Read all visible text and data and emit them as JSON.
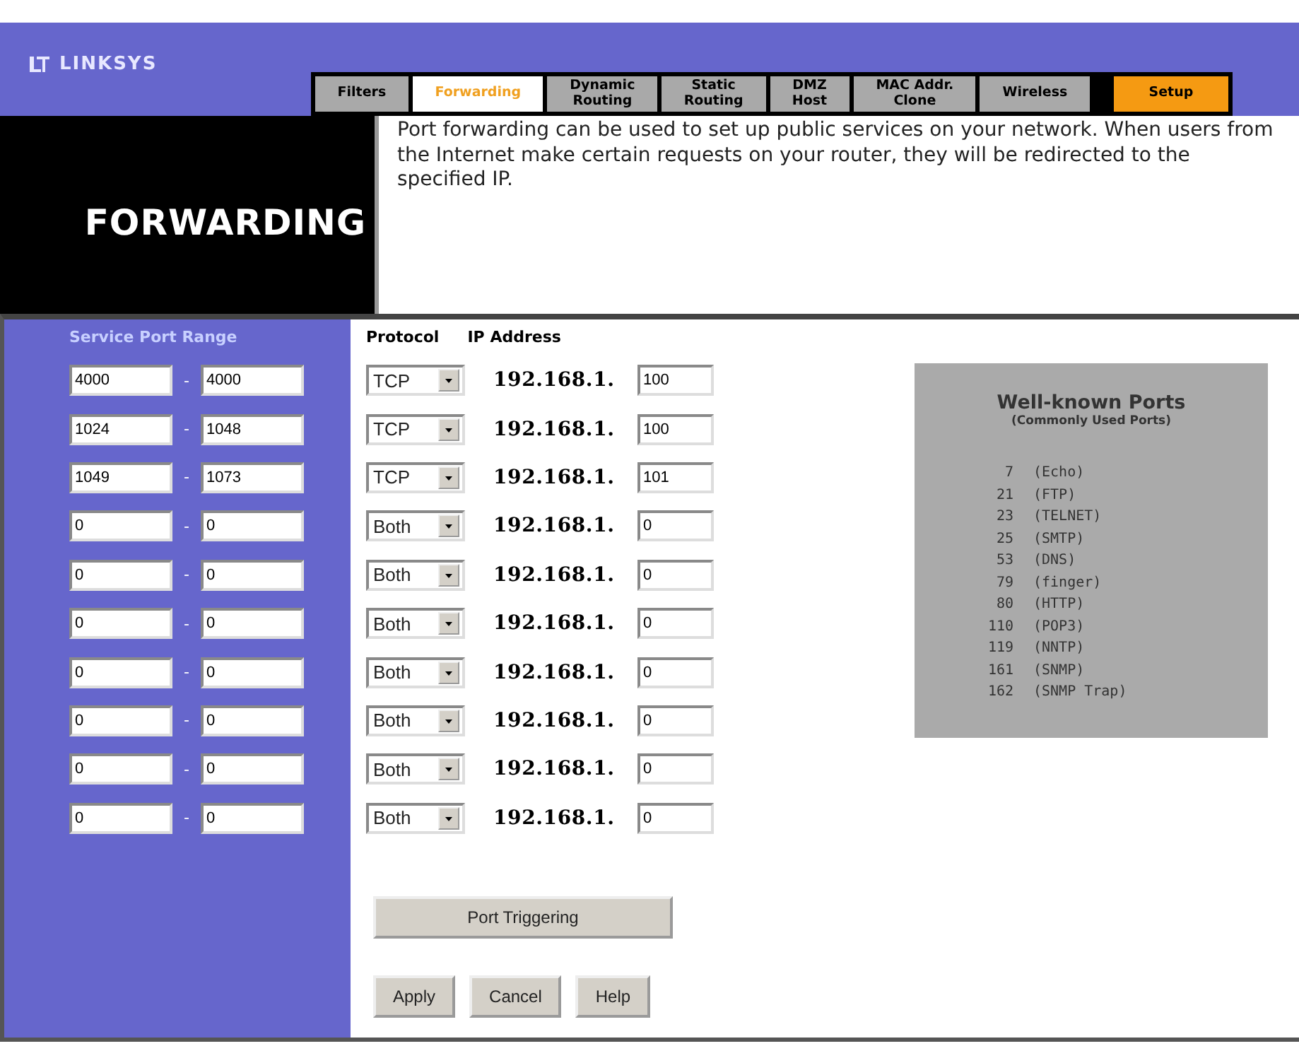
{
  "logo": {
    "text": "LINKSYS"
  },
  "tabs": [
    {
      "label": "Filters",
      "kind": "tab",
      "selected": false
    },
    {
      "label": "Forwarding",
      "kind": "tab",
      "selected": true
    },
    {
      "label": "Dynamic\nRouting",
      "kind": "tab",
      "selected": false
    },
    {
      "label": "Static\nRouting",
      "kind": "tab",
      "selected": false
    },
    {
      "label": "DMZ\nHost",
      "kind": "tab",
      "selected": false
    },
    {
      "label": "MAC Addr.\nClone",
      "kind": "tab",
      "selected": false
    },
    {
      "label": "Wireless",
      "kind": "tab",
      "selected": false
    },
    {
      "label": "Setup",
      "kind": "setup",
      "selected": false
    }
  ],
  "page_title": "FORWARDING",
  "description": "Port forwarding can be used to set up public services on your network. When users from the Internet make certain requests on your router, they will be redirected to the specified IP.",
  "columns": {
    "port_range": "Service Port Range",
    "protocol": "Protocol",
    "ip_address": "IP Address"
  },
  "rows": [
    {
      "start": "4000",
      "separator": "-",
      "end": "4000",
      "protocol": "TCP",
      "ip_prefix": "192.168.1.",
      "ip_last": "100"
    },
    {
      "start": "1024",
      "separator": "-",
      "end": "1048",
      "protocol": "TCP",
      "ip_prefix": "192.168.1.",
      "ip_last": "100"
    },
    {
      "start": "1049",
      "separator": "-",
      "end": "1073",
      "protocol": "TCP",
      "ip_prefix": "192.168.1.",
      "ip_last": "101"
    },
    {
      "start": "0",
      "separator": "-",
      "end": "0",
      "protocol": "Both",
      "ip_prefix": "192.168.1.",
      "ip_last": "0"
    },
    {
      "start": "0",
      "separator": "-",
      "end": "0",
      "protocol": "Both",
      "ip_prefix": "192.168.1.",
      "ip_last": "0"
    },
    {
      "start": "0",
      "separator": "-",
      "end": "0",
      "protocol": "Both",
      "ip_prefix": "192.168.1.",
      "ip_last": "0"
    },
    {
      "start": "0",
      "separator": "-",
      "end": "0",
      "protocol": "Both",
      "ip_prefix": "192.168.1.",
      "ip_last": "0"
    },
    {
      "start": "0",
      "separator": "-",
      "end": "0",
      "protocol": "Both",
      "ip_prefix": "192.168.1.",
      "ip_last": "0"
    },
    {
      "start": "0",
      "separator": "-",
      "end": "0",
      "protocol": "Both",
      "ip_prefix": "192.168.1.",
      "ip_last": "0"
    },
    {
      "start": "0",
      "separator": "-",
      "end": "0",
      "protocol": "Both",
      "ip_prefix": "192.168.1.",
      "ip_last": "0"
    }
  ],
  "well_known_ports": {
    "title": "Well-known Ports",
    "subtitle": "(Commonly Used Ports)",
    "ports": [
      {
        "port": "7",
        "service": "(Echo)"
      },
      {
        "port": "21",
        "service": "(FTP)"
      },
      {
        "port": "23",
        "service": "(TELNET)"
      },
      {
        "port": "25",
        "service": "(SMTP)"
      },
      {
        "port": "53",
        "service": "(DNS)"
      },
      {
        "port": "79",
        "service": "(finger)"
      },
      {
        "port": "80",
        "service": "(HTTP)"
      },
      {
        "port": "110",
        "service": "(POP3)"
      },
      {
        "port": "119",
        "service": "(NNTP)"
      },
      {
        "port": "161",
        "service": "(SNMP)"
      },
      {
        "port": "162",
        "service": "(SNMP Trap)"
      }
    ]
  },
  "port_triggering_button": "Port Triggering",
  "buttons": [
    "Apply",
    "Cancel",
    "Help"
  ]
}
